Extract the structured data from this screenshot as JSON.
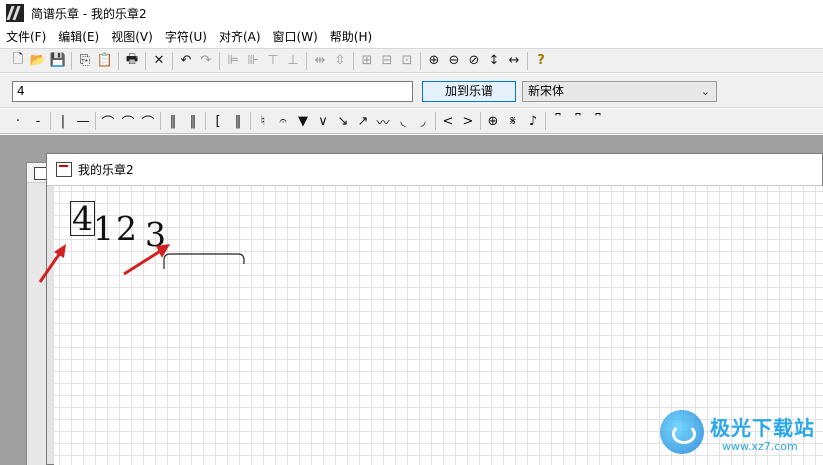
{
  "window": {
    "title": "简谱乐章 - 我的乐章2"
  },
  "menu": [
    {
      "label": "文件(F)"
    },
    {
      "label": "编辑(E)"
    },
    {
      "label": "视图(V)"
    },
    {
      "label": "字符(U)"
    },
    {
      "label": "对齐(A)"
    },
    {
      "label": "窗口(W)"
    },
    {
      "label": "帮助(H)"
    }
  ],
  "toolbar": {
    "new": "🗋",
    "open": "📂",
    "save": "💾",
    "copy": "⎘",
    "paste": "📋",
    "print": "🖶",
    "delete": "✕",
    "undo": "↶",
    "redo": "↷",
    "align_left": "⊫",
    "align_right": "⊪",
    "align_top": "⊤",
    "align_bottom": "⊥",
    "space_h": "⇹",
    "space_v": "⇳",
    "group": "⊞",
    "ungroup": "⊟",
    "frame": "⊡",
    "zoom_in": "⊕",
    "zoom_out": "⊖",
    "zoom_fit": "⊘",
    "fit_height": "↕",
    "fit_width": "↔",
    "help": "?"
  },
  "input_bar": {
    "text_value": "4",
    "add_button": "加到乐谱",
    "font_value": "新宋体",
    "dropdown_glyph": "⌄"
  },
  "symbols": [
    "·",
    "-",
    "|",
    "—",
    "⌒",
    "⌒",
    "⌒",
    "‖",
    "‖",
    "[",
    "‖",
    "♮",
    "𝄐",
    "▼",
    "∨",
    "↘",
    "↗",
    "〰",
    "◟",
    "◞",
    "<",
    ">",
    "⊕",
    "𝄋",
    "♪",
    "⎴",
    "⎴",
    "⎴"
  ],
  "doc_window": {
    "title": "我的乐章2"
  },
  "score": {
    "notes": [
      "4",
      "1",
      "2",
      "3"
    ]
  },
  "colors": {
    "arrow": "#d42020",
    "watermark": "#2aa7e8"
  },
  "watermark": {
    "brand": "极光下载站",
    "url": "www.xz7.com"
  }
}
